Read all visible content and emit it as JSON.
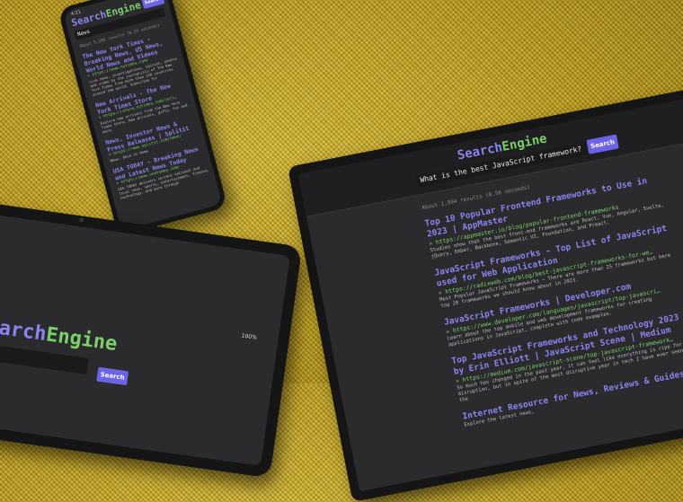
{
  "laptop": {
    "logo_a": "Search",
    "logo_b": "Engine",
    "query": "What is the best JavaScript framework?",
    "button": "Search",
    "meta": "About 1,994 results (0.56 seconds)",
    "results": [
      {
        "title": "Top 10 Popular Frontend Frameworks to Use in 2023 | AppMaster",
        "url": "» https://appmaster.io/blog/popular-frontend-frameworks",
        "desc": "Studies show that the best front-end frameworks are React, Vue, Angular, Svelte, jQuery, Ember, Backbone, Semantic UI, Foundation, and Preact."
      },
      {
        "title": "JavaScript Frameworks - Top List of JavaScript used for Web Application",
        "url": "» https://radixweb.com/blog/best-javascript-frameworks-for-we…",
        "desc": "Most Popular JavaScript Frameworks — There are more than 25 frameworks but here top 20 frameworks we should know about in 2023."
      },
      {
        "title": "JavaScript Frameworks | Developer.com",
        "url": "» https://www.developer.com/languages/javascript/top-javascri…",
        "desc": "Learn about the top mobile and web development frameworks for creating applications in JavaScript, complete with code examples."
      },
      {
        "title": "Top JavaScript Frameworks and Technology 2023 | by Erin Elliott | JavaScript Scene | Medium",
        "url": "» https://medium.com/javascript-scene/top-javascript-framework…",
        "desc": "So much has changed in the past year, it can feel like everything is ripe for disruption, but in spite of the most disruptive year in tech I have ever seen, the"
      },
      {
        "title": "Internet Resource for News, Reviews & Guides |",
        "url": "",
        "desc": "Explore the latest news,"
      }
    ]
  },
  "phone": {
    "status": "4:21",
    "logo_a": "Search",
    "logo_b": "Engine",
    "button": "Search",
    "query": "News",
    "meta": "About 5,286 results (0.19 seconds)",
    "results": [
      {
        "title": "The New York Times - Breaking News, US News, World News and Videos",
        "url": "» https://www.nytimes.com/",
        "desc": "Live news, investigations, opinion, photos and video by the journalists of The New York Times from more than 150 countries around the world. Subscribe for"
      },
      {
        "title": "New Arrivals - The New York Times Store",
        "url": "» https://store.nytimes.com/coll…",
        "desc": "Explore new arrivals from the New York Times Store. New arrivals, gifts, fun and more."
      },
      {
        "title": "News, Investor News & Press Releases | Splitit",
        "url": "» https://www.splitit.com/news/",
        "desc": "News. Back to Home"
      },
      {
        "title": "USA TODAY - Breaking News and Latest News Today",
        "url": "» https://www.usatoday.com/",
        "desc": "USA TODAY delivers current national and local news, sports, entertainment, finance, technology, and more through"
      }
    ]
  },
  "tablet": {
    "status": "100%",
    "logo_a": "Search",
    "logo_b": "Engine",
    "button": "Search"
  }
}
